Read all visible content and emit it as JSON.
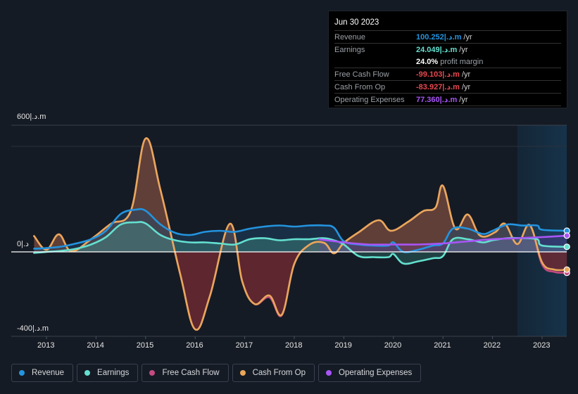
{
  "tooltip": {
    "date": "Jun 30 2023",
    "rows": [
      {
        "label": "Revenue",
        "value": "100.252|.د.m",
        "unit": "/yr",
        "color": "#2394df"
      },
      {
        "label": "Earnings",
        "value": "24.049|.د.m",
        "unit": "/yr",
        "color": "#64e0d0"
      },
      {
        "label": "",
        "value": "24.0%",
        "unit": "profit margin",
        "color": "#ffffff"
      },
      {
        "label": "Free Cash Flow",
        "value": "-99.103|.د.m",
        "unit": "/yr",
        "color": "#e84850"
      },
      {
        "label": "Cash From Op",
        "value": "-83.927|.د.m",
        "unit": "/yr",
        "color": "#e84850"
      },
      {
        "label": "Operating Expenses",
        "value": "77.360|.د.m",
        "unit": "/yr",
        "color": "#a855f7"
      }
    ]
  },
  "legend": [
    {
      "label": "Revenue",
      "color": "#2394df"
    },
    {
      "label": "Earnings",
      "color": "#64e0d0"
    },
    {
      "label": "Free Cash Flow",
      "color": "#c44a82"
    },
    {
      "label": "Cash From Op",
      "color": "#e8a75a"
    },
    {
      "label": "Operating Expenses",
      "color": "#a855f7"
    }
  ],
  "chart_data": {
    "type": "area",
    "title": "",
    "xlabel": "",
    "ylabel": "",
    "y_tick_labels": [
      "600|.د.m",
      "0|.د",
      "-400|.د.m"
    ],
    "y_ticks": [
      600,
      0,
      -400
    ],
    "ylim": [
      -400,
      600
    ],
    "xlim": [
      2012.75,
      2023.5
    ],
    "x_tick_labels": [
      "2013",
      "2014",
      "2015",
      "2016",
      "2017",
      "2018",
      "2019",
      "2020",
      "2021",
      "2022",
      "2023"
    ],
    "x_ticks": [
      2013,
      2014,
      2015,
      2016,
      2017,
      2018,
      2019,
      2020,
      2021,
      2022,
      2023
    ],
    "forecast_shading_start": 2022.5,
    "series": [
      {
        "name": "Revenue",
        "color": "#2394df",
        "x": [
          2012.75,
          2013.0,
          2013.3,
          2013.6,
          2013.9,
          2014.2,
          2014.5,
          2014.8,
          2015.0,
          2015.3,
          2015.6,
          2015.9,
          2016.2,
          2016.5,
          2016.8,
          2017.1,
          2017.4,
          2017.7,
          2018.0,
          2018.3,
          2018.6,
          2018.8,
          2019.0,
          2019.3,
          2019.6,
          2019.9,
          2020.0,
          2020.2,
          2020.5,
          2020.8,
          2021.0,
          2021.2,
          2021.5,
          2021.8,
          2022.0,
          2022.3,
          2022.6,
          2022.9,
          2023.0,
          2023.5
        ],
        "values": [
          15,
          18,
          25,
          40,
          60,
          100,
          180,
          200,
          195,
          130,
          90,
          80,
          95,
          100,
          95,
          110,
          120,
          125,
          120,
          125,
          125,
          115,
          50,
          35,
          30,
          30,
          45,
          0,
          10,
          30,
          40,
          110,
          110,
          85,
          100,
          130,
          125,
          125,
          105,
          100
        ]
      },
      {
        "name": "Earnings",
        "color": "#64e0d0",
        "x": [
          2012.75,
          2013.0,
          2013.3,
          2013.6,
          2013.9,
          2014.2,
          2014.5,
          2014.8,
          2015.0,
          2015.3,
          2015.6,
          2015.9,
          2016.2,
          2016.5,
          2016.8,
          2017.1,
          2017.4,
          2017.7,
          2018.0,
          2018.3,
          2018.6,
          2018.8,
          2019.0,
          2019.3,
          2019.6,
          2019.9,
          2020.0,
          2020.2,
          2020.5,
          2020.8,
          2021.0,
          2021.2,
          2021.5,
          2021.8,
          2022.0,
          2022.3,
          2022.6,
          2022.9,
          2023.0,
          2023.5
        ],
        "values": [
          -5,
          0,
          5,
          15,
          35,
          70,
          130,
          140,
          135,
          80,
          55,
          45,
          45,
          40,
          35,
          60,
          65,
          55,
          60,
          60,
          65,
          55,
          35,
          -20,
          -25,
          -25,
          -10,
          -55,
          -45,
          -30,
          -20,
          60,
          60,
          45,
          55,
          65,
          65,
          60,
          30,
          24
        ]
      },
      {
        "name": "Free Cash Flow",
        "color": "#c44a82",
        "x": [
          2012.75,
          2013.0,
          2013.25,
          2013.5,
          2013.9,
          2014.3,
          2014.7,
          2015.0,
          2015.3,
          2015.7,
          2016.0,
          2016.3,
          2016.7,
          2016.95,
          2017.2,
          2017.5,
          2017.75,
          2018.0,
          2018.3,
          2018.6,
          2018.8,
          2019.0,
          2019.3,
          2019.7,
          2019.95,
          2020.3,
          2020.6,
          2020.85,
          2021.0,
          2021.25,
          2021.5,
          2021.75,
          2022.05,
          2022.25,
          2022.5,
          2022.75,
          2023.0,
          2023.25,
          2023.5
        ],
        "values": [
          75,
          10,
          83,
          3,
          60,
          133,
          193,
          537,
          293,
          -107,
          -367,
          -207,
          133,
          -140,
          -247,
          -215,
          -300,
          -57,
          33,
          43,
          -7,
          43,
          93,
          150,
          100,
          143,
          193,
          210,
          313,
          110,
          177,
          77,
          93,
          133,
          37,
          127,
          -60,
          -95,
          -99
        ]
      },
      {
        "name": "Cash From Op",
        "color": "#e8a75a",
        "x": [
          2012.75,
          2013.0,
          2013.25,
          2013.5,
          2013.9,
          2014.3,
          2014.7,
          2015.0,
          2015.3,
          2015.7,
          2016.0,
          2016.3,
          2016.7,
          2016.95,
          2017.2,
          2017.5,
          2017.75,
          2018.0,
          2018.3,
          2018.6,
          2018.8,
          2019.0,
          2019.3,
          2019.7,
          2019.95,
          2020.3,
          2020.6,
          2020.85,
          2021.0,
          2021.25,
          2021.5,
          2021.75,
          2022.05,
          2022.25,
          2022.5,
          2022.75,
          2023.0,
          2023.25,
          2023.5
        ],
        "values": [
          75,
          10,
          83,
          3,
          60,
          133,
          193,
          537,
          293,
          -107,
          -367,
          -207,
          133,
          -140,
          -247,
          -207,
          -297,
          -57,
          33,
          43,
          -7,
          43,
          93,
          150,
          100,
          143,
          193,
          210,
          313,
          110,
          177,
          77,
          93,
          133,
          37,
          127,
          -50,
          -84,
          -84
        ]
      },
      {
        "name": "Operating Expenses",
        "color": "#a855f7",
        "x": [
          2018.5,
          2019.0,
          2019.5,
          2020.0,
          2020.5,
          2021.0,
          2021.5,
          2022.0,
          2022.5,
          2023.0,
          2023.5
        ],
        "values": [
          60,
          45,
          35,
          35,
          35,
          40,
          50,
          60,
          65,
          70,
          77
        ]
      }
    ]
  }
}
